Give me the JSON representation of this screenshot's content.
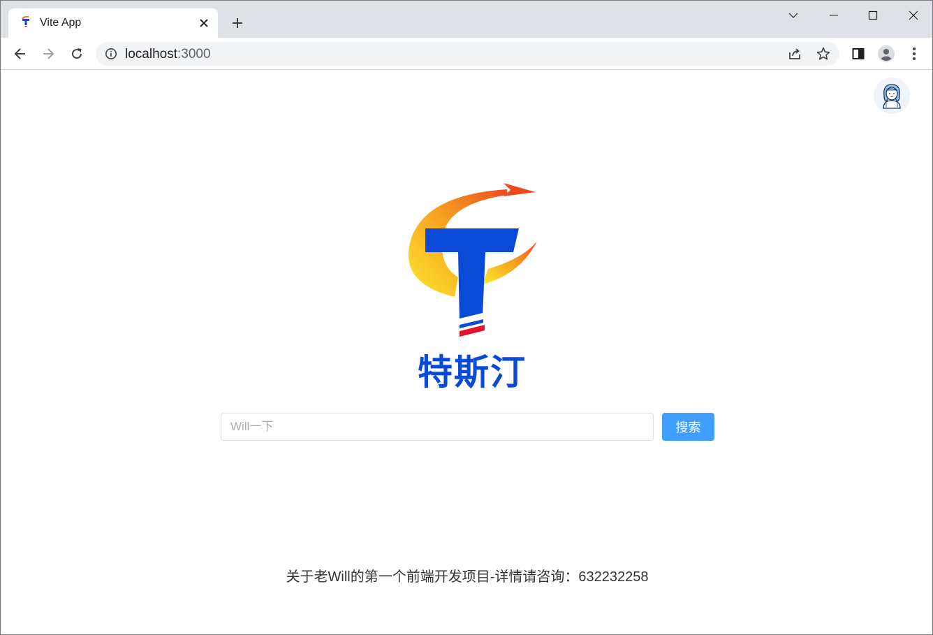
{
  "browser": {
    "tab": {
      "title": "Vite App",
      "favicon": "brand-t-favicon"
    },
    "url": {
      "host": "localhost",
      "port": ":3000"
    },
    "icons": {
      "back": "arrow-left-icon",
      "forward": "arrow-right-icon",
      "reload": "reload-icon",
      "info": "info-icon",
      "share": "share-icon",
      "bookmark": "star-icon",
      "side_panel": "side-panel-icon",
      "profile": "profile-icon",
      "menu": "kebab-menu-icon",
      "tab_search": "chevron-down-icon",
      "minimize": "minimize-icon",
      "maximize": "maximize-icon",
      "close": "close-icon"
    }
  },
  "page": {
    "logo": {
      "text": "特斯汀"
    },
    "search": {
      "placeholder": "Will一下",
      "value": "",
      "button_label": "搜索"
    },
    "footer": {
      "text": "关于老Will的第一个前端开发项目-详情请咨询：632232258"
    }
  },
  "colors": {
    "accent": "#409eff",
    "logo_blue": "#0a4ad6",
    "logo_red": "#e5132a",
    "logo_orange": "#f36b21",
    "logo_yellow": "#fbd82a"
  }
}
